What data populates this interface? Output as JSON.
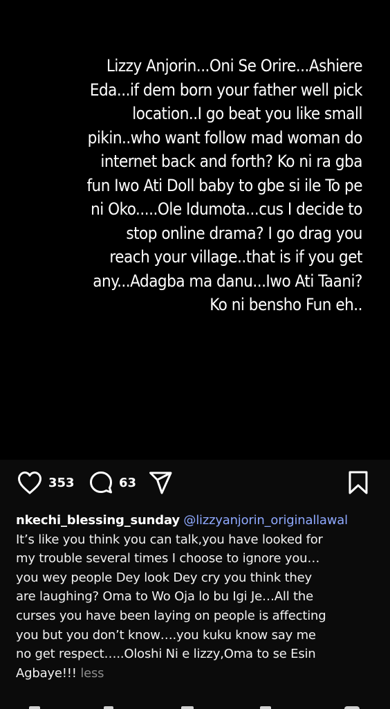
{
  "post": {
    "text_lines": [
      "Lizzy Anjorin...Oni Se Orire...Ashiere",
      "Eda...if dem born your father well pick",
      "location..I go beat you like small",
      "pikin..who want follow mad woman do",
      "internet back and forth? Ko ni ra gba",
      "fun Iwo Ati Doll baby to gbe si ile To pe",
      "ni Oko.....Ole Idumota...cus I decide to",
      "stop online drama? I go drag you",
      "reach your village..that is if you get",
      "any...Adagba ma danu...Iwo Ati Taani?",
      "Ko ni bensho Fun eh.."
    ]
  },
  "actions": {
    "likes": "353",
    "comments": "63",
    "icons": [
      "heart-icon",
      "comment-icon",
      "share-icon",
      "bookmark-icon"
    ]
  },
  "caption": {
    "username": "nkechi_blessing_sunday",
    "mention": "@lizzyanjorin_originallawal",
    "lines": [
      "It’s like you think you can talk,you have looked for",
      "my trouble several times I choose to ignore you…",
      "you wey people Dey look Dey cry you think they",
      "are laughing? Oma to Wo Oja lo bu Igi Je…All the",
      "curses you have been laying on people is affecting",
      "you but you don’t know….you kuku know say me",
      "no get respect…..Oloshi Ni e lizzy,Oma to se Esin"
    ],
    "last_line": "Agbaye!!!",
    "less_label": "less"
  },
  "colors": {
    "background": "#000000",
    "panel": "#0b0b0b",
    "text": "#ffffff",
    "mention": "#8fa9ff",
    "muted": "#8e8e8e"
  }
}
